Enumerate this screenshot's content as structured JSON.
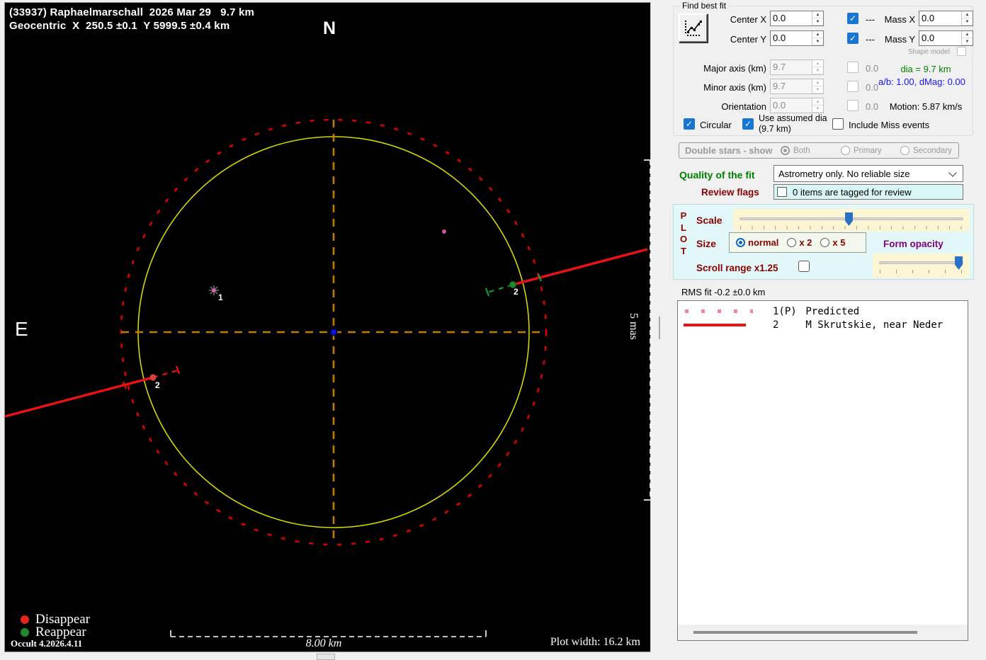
{
  "plot": {
    "title_line1": "(33937) Raphaelmarschall  2026 Mar 29   9.7 km",
    "title_line2": "Geocentric  X  250.5 ±0.1  Y 5999.5 ±0.4 km",
    "north_label": "N",
    "east_label": "E",
    "star_marker_label": "1",
    "chord_left_label": "2",
    "chord_right_label": "2",
    "legend": {
      "disappear": "Disappear",
      "reappear": "Reappear"
    },
    "version": "Occult 4.2026.4.11",
    "scale_bar_label": "8.00 km",
    "plot_width_label": "Plot width: 16.2 km",
    "mas_scale_label": "5 mas",
    "colors": {
      "asteroid_outline": "#d6d600",
      "uncertainty_circle": "#dd0000",
      "crosshair": "#c17c00",
      "center_dot": "#1414e0",
      "chord": "#ee1111",
      "disappear": "#e8241c",
      "reappear": "#1f8a2d",
      "predicted": "#ef7fb4"
    }
  },
  "panel": {
    "find_best_fit": {
      "group_label": "Find best fit",
      "fit_button": "fit-chart-icon",
      "center_x": {
        "label": "Center X",
        "value": "0.0",
        "suffix": "---"
      },
      "center_y": {
        "label": "Center Y",
        "value": "0.0",
        "suffix": "---"
      },
      "mass_x": {
        "label": "Mass X",
        "value": "0.0"
      },
      "mass_y": {
        "label": "Mass Y",
        "value": "0.0"
      },
      "shape_model_label": "Shape model",
      "major_axis": {
        "label": "Major axis (km)",
        "value": "9.7",
        "aux": "0.0"
      },
      "minor_axis": {
        "label": "Minor axis (km)",
        "value": "9.7",
        "aux": "0.0"
      },
      "orientation": {
        "label": "Orientation",
        "value": "0.0",
        "aux": "0.0"
      },
      "dia_text": "dia = 9.7 km",
      "ab_text": "a/b: 1.00, dMag: 0.00",
      "motion_text": "Motion: 5.87 km/s",
      "circular_label": "Circular",
      "use_assumed_label": "Use assumed dia (9.7 km)",
      "include_miss_label": "Include Miss events"
    },
    "double_stars": {
      "group_label": "Double stars - show",
      "options": [
        "Both",
        "Primary",
        "Secondary"
      ],
      "selected": "Both"
    },
    "quality": {
      "label": "Quality of the fit",
      "value": "Astrometry only. No reliable size"
    },
    "review": {
      "label": "Review flags",
      "text": "0 items are tagged for review"
    },
    "plot_controls": {
      "plot_vertical": [
        "P",
        "L",
        "O",
        "T"
      ],
      "scale_label": "Scale",
      "size_label": "Size",
      "size_options": [
        "normal",
        "x 2",
        "x 5"
      ],
      "size_selected": "normal",
      "form_opacity_label": "Form opacity",
      "scroll_range_label": "Scroll range x1.25"
    },
    "rms_text": "RMS fit -0.2 ±0.0 km",
    "legend_list": [
      {
        "id": "1(P)",
        "name": "Predicted"
      },
      {
        "id": "2",
        "name": "M Skrutskie, near Neder"
      }
    ]
  }
}
